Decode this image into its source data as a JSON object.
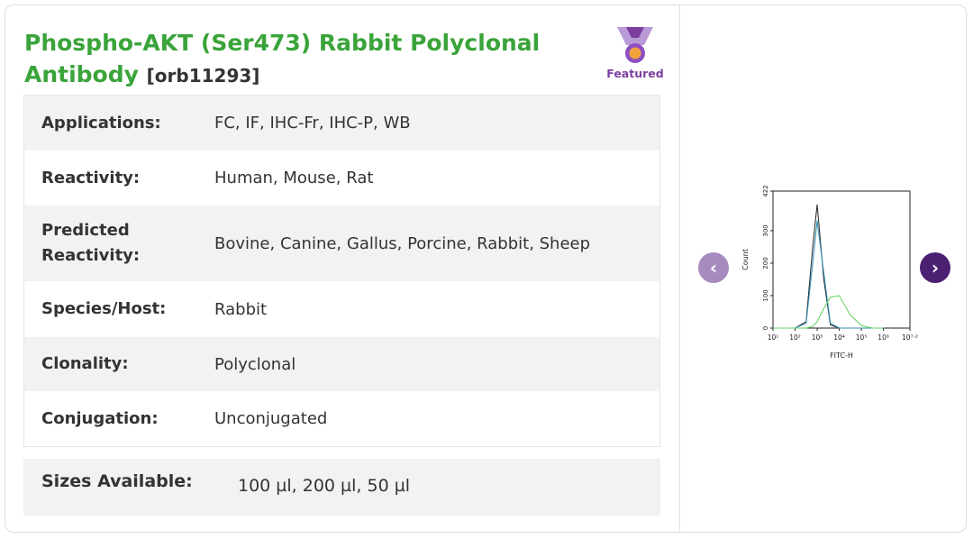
{
  "product": {
    "title": "Phospho-AKT (Ser473) Rabbit Polyclonal Antibody",
    "sku": "[orb11293]",
    "badge": "Featured"
  },
  "specs": [
    {
      "label": "Applications:",
      "value": "FC,  IF,  IHC-Fr,  IHC-P,  WB"
    },
    {
      "label": "Reactivity:",
      "value": "Human, Mouse, Rat"
    },
    {
      "label": "Predicted Reactivity:",
      "value": "Bovine, Canine, Gallus, Porcine, Rabbit, Sheep"
    },
    {
      "label": "Species/Host:",
      "value": "Rabbit"
    },
    {
      "label": "Clonality:",
      "value": "Polyclonal"
    },
    {
      "label": "Conjugation:",
      "value": "Unconjugated"
    }
  ],
  "sizes": {
    "label": "Sizes Available:",
    "value": "100 µl, 200 µl, 50 µl"
  },
  "gallery": {
    "prev_icon": "chevron-left-icon",
    "next_icon": "chevron-right-icon"
  },
  "chart_data": {
    "type": "line",
    "xlabel": "FITC-H",
    "ylabel": "Count",
    "ylim": [
      0,
      422
    ],
    "xscale": "log",
    "yticks": [
      "0",
      "100",
      "200",
      "300",
      "422"
    ],
    "xticks": [
      "10¹",
      "10²",
      "10³",
      "10⁴",
      "10⁵",
      "10⁶",
      "10⁷·²"
    ],
    "x": [
      1,
      1.5,
      2,
      2.5,
      2.8,
      3,
      3.3,
      3.6,
      4,
      4.5,
      5,
      5.5,
      6
    ],
    "series": [
      {
        "color": "#222222",
        "values": [
          0,
          0,
          0,
          20,
          250,
          380,
          150,
          10,
          0,
          0,
          0,
          0,
          0
        ]
      },
      {
        "color": "#2e8fb8",
        "values": [
          0,
          0,
          0,
          15,
          200,
          330,
          170,
          15,
          0,
          0,
          0,
          0,
          0
        ]
      },
      {
        "color": "#5cd25c",
        "values": [
          0,
          0,
          0,
          0,
          5,
          20,
          60,
          95,
          100,
          40,
          8,
          0,
          0
        ]
      }
    ]
  }
}
